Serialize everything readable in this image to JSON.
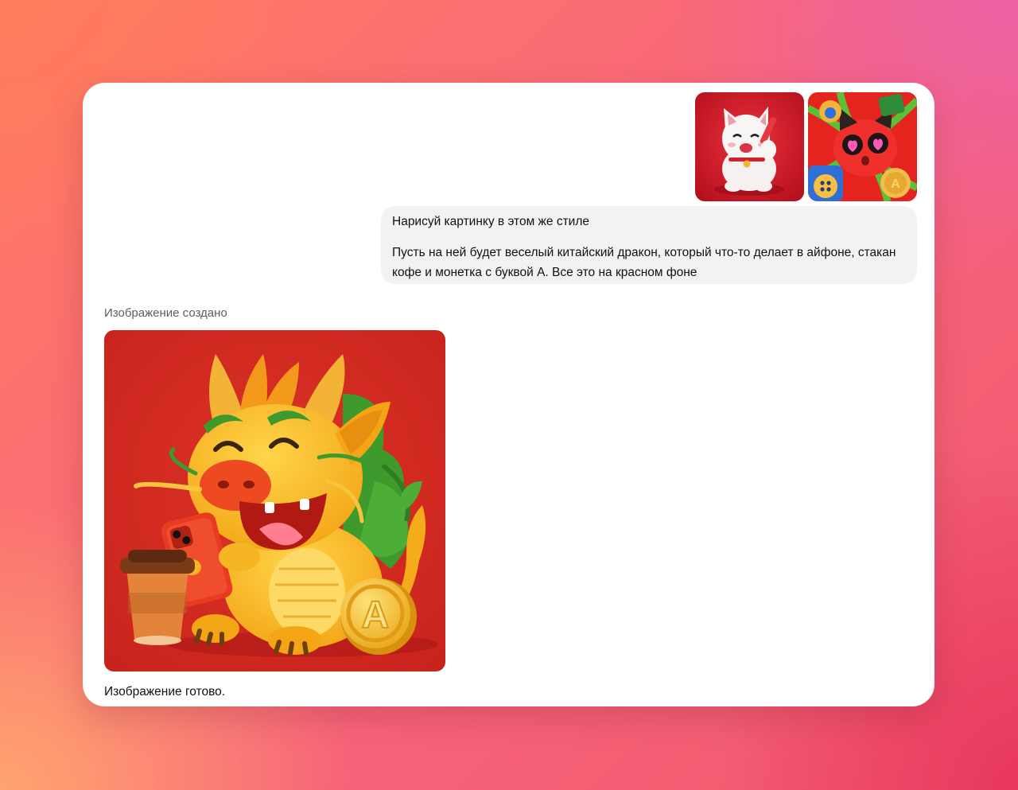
{
  "conversation": {
    "user_message": {
      "attachments": [
        {
          "icon": "lucky-cat-image"
        },
        {
          "icon": "red-cartoon-cat-image"
        }
      ],
      "paragraphs": [
        "Нарисуй картинку в этом же стиле",
        "Пусть на ней будет веселый китайский дракон, который что-то делает в айфоне, стакан кофе и монетка с буквой А. Все это на красном фоне"
      ]
    },
    "assistant_message": {
      "status": "Изображение создано",
      "image": {
        "icon": "dragon-image",
        "coin_letter": "A"
      },
      "caption": "Изображение готово."
    }
  },
  "colors": {
    "card": "#ffffff",
    "bubble": "#f2f2f2",
    "status_text": "#5d5d5d",
    "image_red": "#d42a22"
  }
}
